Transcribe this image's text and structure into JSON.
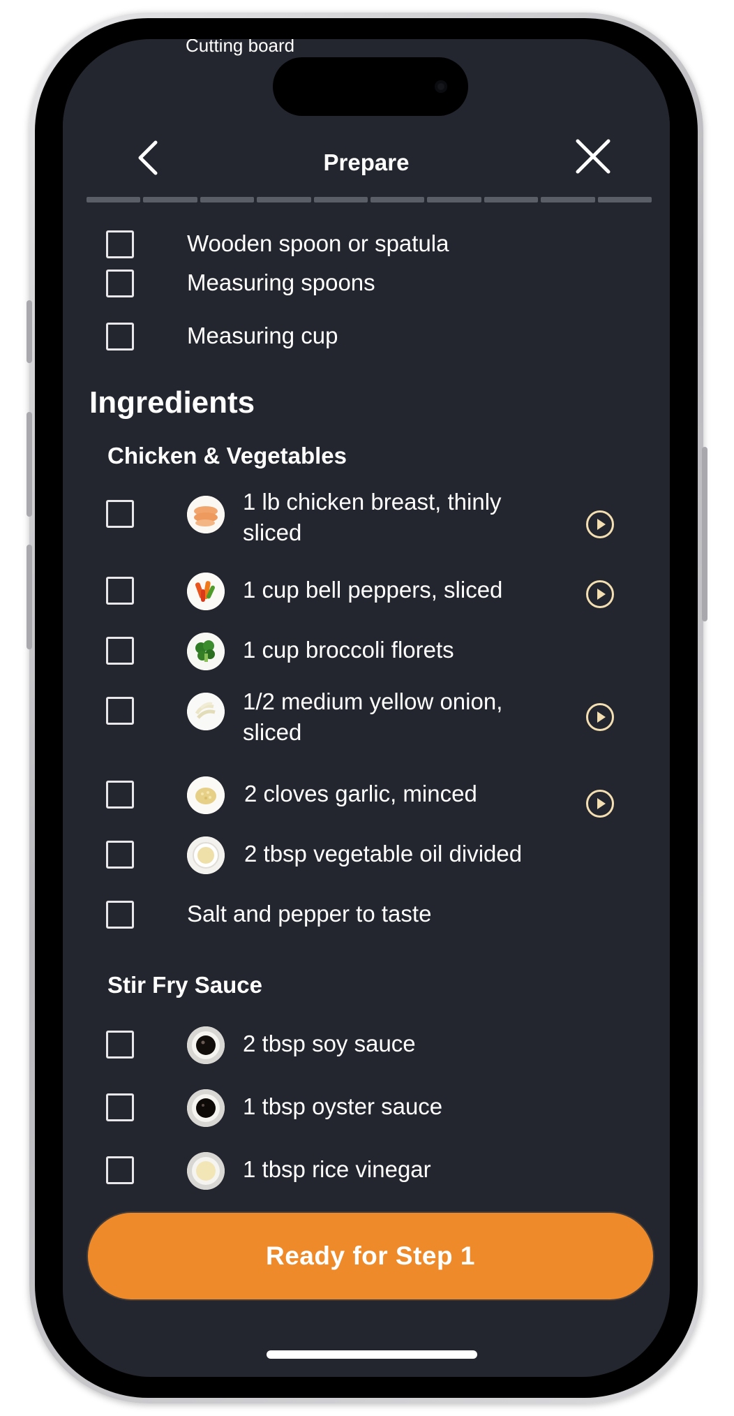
{
  "header": {
    "title": "Prepare",
    "back_label": "back",
    "close_label": "close"
  },
  "progress": {
    "segments": 10
  },
  "peek": {
    "text": "Cutting board"
  },
  "equipment": [
    {
      "label": "Wooden spoon or spatula"
    },
    {
      "label": "Measuring spoons"
    },
    {
      "label": "Measuring cup"
    }
  ],
  "ingredients": {
    "title": "Ingredients",
    "groups": [
      {
        "title": "Chicken & Vegetables",
        "items": [
          {
            "label": "1 lb chicken breast, thinly sliced",
            "line1": "1 lb chicken breast, thinly",
            "line2": "sliced",
            "thumb": "chicken-thumb",
            "has_video": true
          },
          {
            "label": "1 cup bell peppers, sliced",
            "thumb": "bell-peppers-thumb",
            "has_video": true
          },
          {
            "label": "1 cup broccoli florets",
            "thumb": "broccoli-thumb",
            "has_video": false
          },
          {
            "label": "1/2 medium yellow onion, sliced",
            "line1": "1/2 medium yellow onion,",
            "line2": "sliced",
            "thumb": "onion-thumb",
            "has_video": true
          },
          {
            "label": "2 cloves garlic, minced",
            "thumb": "garlic-thumb",
            "has_video": true
          },
          {
            "label": "2 tbsp vegetable oil divided",
            "thumb": "oil-thumb",
            "has_video": false
          },
          {
            "label": "Salt and pepper to taste",
            "thumb": null,
            "has_video": false
          }
        ]
      },
      {
        "title": "Stir Fry Sauce",
        "items": [
          {
            "label": "2 tbsp soy sauce",
            "thumb": "soy-sauce-thumb"
          },
          {
            "label": "1 tbsp oyster sauce",
            "thumb": "oyster-sauce-thumb"
          },
          {
            "label": "1 tbsp rice vinegar",
            "thumb": "rice-vinegar-thumb"
          }
        ]
      }
    ]
  },
  "cta": {
    "label": "Ready for Step 1"
  },
  "colors": {
    "background": "#23262e",
    "accent": "#ef8a2a",
    "play_icon": "#f3dfb2",
    "checkbox_border": "#e8e8ea"
  }
}
